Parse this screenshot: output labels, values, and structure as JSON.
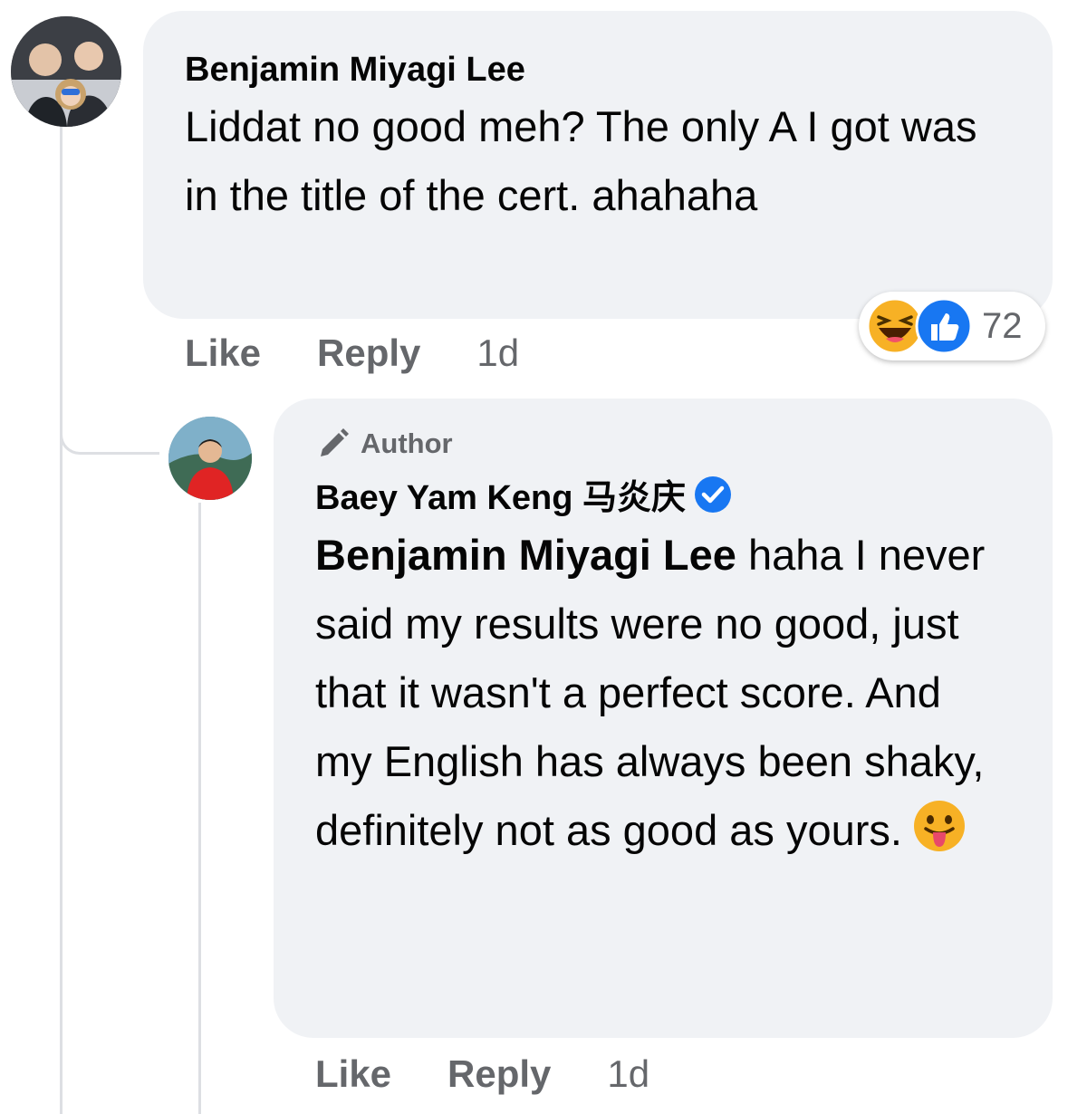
{
  "comment": {
    "author": "Benjamin Miyagi Lee",
    "text": "Liddat no good meh? The only A I got was in the title of the cert. ahahaha",
    "reactions": {
      "count": "72",
      "types": [
        "haha-icon",
        "like-icon"
      ]
    },
    "actions": {
      "like": "Like",
      "reply": "Reply",
      "time": "1d"
    }
  },
  "reply": {
    "badge": "Author",
    "author": "Baey Yam Keng 马炎庆",
    "verified": true,
    "mention": "Benjamin Miyagi Lee",
    "text": " haha I never said my results were no good, just that it wasn't a perfect score. And my English has always been shaky, definitely not as good as yours.",
    "emoji": "tongue-out-emoji",
    "actions": {
      "like": "Like",
      "reply": "Reply",
      "time": "1d"
    }
  },
  "colors": {
    "bubble": "#f0f2f5",
    "meta_text": "#65676b",
    "verified_blue": "#1877f2",
    "like_blue": "#1877f2",
    "haha_yellow": "#f7b125"
  }
}
